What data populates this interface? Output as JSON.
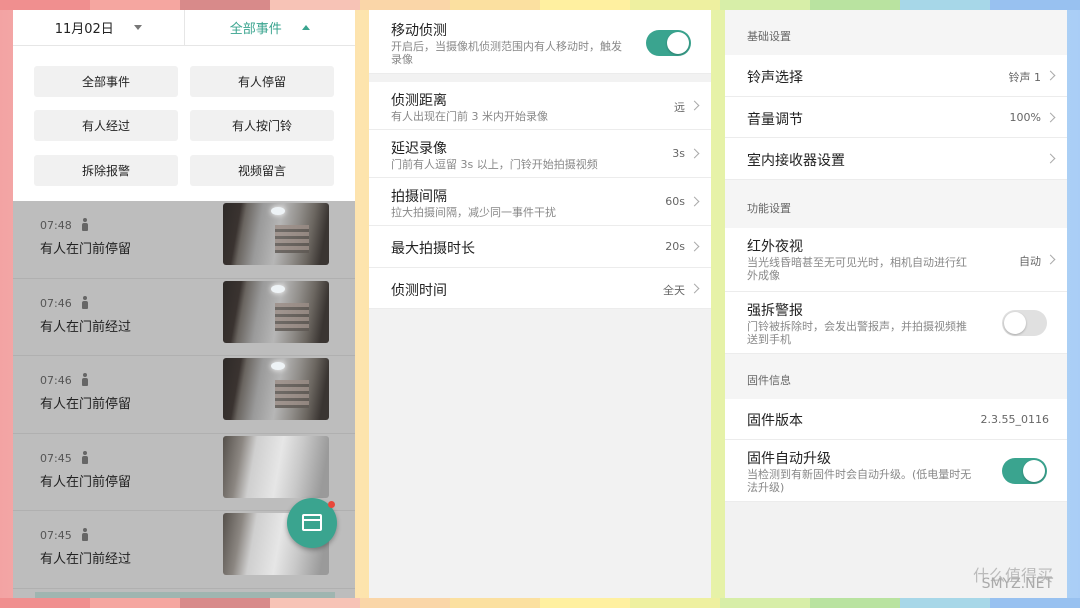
{
  "events_panel": {
    "date": "11月02日",
    "filter": "全部事件",
    "filters": [
      "全部事件",
      "有人停留",
      "有人经过",
      "有人按门铃",
      "拆除报警",
      "视频留言"
    ],
    "events": [
      {
        "time": "07:48",
        "desc": "有人在门前停留"
      },
      {
        "time": "07:46",
        "desc": "有人在门前经过"
      },
      {
        "time": "07:46",
        "desc": "有人在门前停留"
      },
      {
        "time": "07:45",
        "desc": "有人在门前停留"
      },
      {
        "time": "07:45",
        "desc": "有人在门前经过"
      }
    ]
  },
  "detect_panel": {
    "motion": {
      "title": "移动侦测",
      "sub": "开启后，当摄像机侦测范围内有人移动时，触发录像",
      "enabled": true
    },
    "rows": [
      {
        "title": "侦测距离",
        "sub": "有人出现在门前 3 米内开始录像",
        "value": "远"
      },
      {
        "title": "延迟录像",
        "sub": "门前有人逗留 3s 以上，门铃开始拍摄视频",
        "value": "3s"
      },
      {
        "title": "拍摄间隔",
        "sub": "拉大拍摄间隔，减少同一事件干扰",
        "value": "60s"
      },
      {
        "title": "最大拍摄时长",
        "value": "20s"
      },
      {
        "title": "侦测时间",
        "value": "全天"
      }
    ]
  },
  "settings_panel": {
    "basic_section": "基础设置",
    "ringtone": {
      "title": "铃声选择",
      "value": "铃声 1"
    },
    "volume": {
      "title": "音量调节",
      "value": "100%"
    },
    "receiver": {
      "title": "室内接收器设置"
    },
    "func_section": "功能设置",
    "ir": {
      "title": "红外夜视",
      "sub": "当光线昏暗甚至无可见光时，相机自动进行红外成像",
      "value": "自动"
    },
    "tamper": {
      "title": "强拆警报",
      "sub": "门铃被拆除时，会发出警报声，并拍摄视频推送到手机",
      "enabled": false
    },
    "fw_section": "固件信息",
    "fw_version": {
      "title": "固件版本",
      "value": "2.3.55_0116"
    },
    "fw_auto": {
      "title": "固件自动升级",
      "sub": "当检测到有新固件时会自动升级。(低电量时无法升级)",
      "enabled": true
    }
  },
  "watermark": {
    "brand": "什么值得买",
    "site": "SMYZ.NET"
  },
  "colors": {
    "accent": "#3aa48f",
    "badge": "#e8483b"
  }
}
